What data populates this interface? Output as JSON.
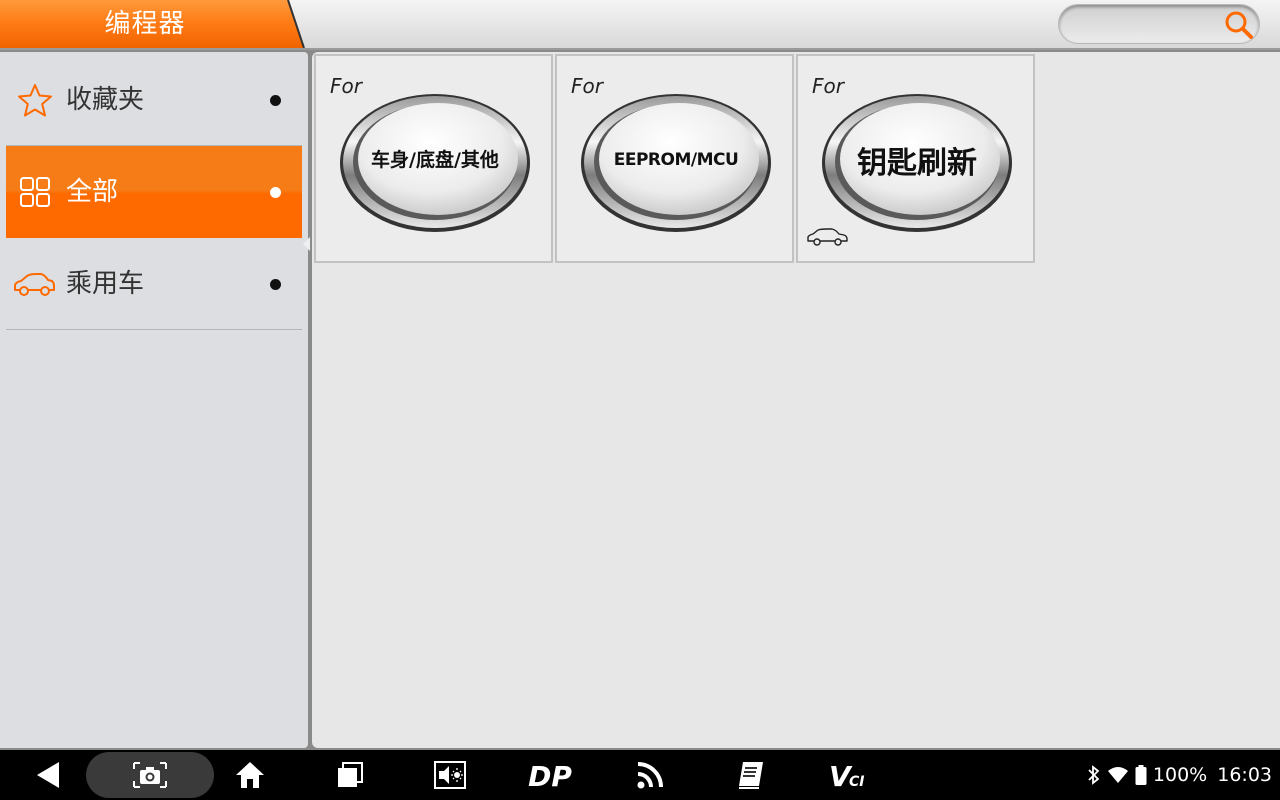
{
  "header": {
    "title": "编程器",
    "search": {
      "value": "",
      "placeholder": ""
    },
    "accent_color": "#ff6a00"
  },
  "sidebar": {
    "items": [
      {
        "label": "收藏夹",
        "icon": "star-icon",
        "active": false
      },
      {
        "label": "全部",
        "icon": "grid-icon",
        "active": true
      },
      {
        "label": "乘用车",
        "icon": "car-icon",
        "active": false
      }
    ]
  },
  "tiles": [
    {
      "for_label": "For",
      "label": "车身/底盘/其他",
      "icon": ""
    },
    {
      "for_label": "For",
      "label": "EEPROM/MCU",
      "icon": ""
    },
    {
      "for_label": "For",
      "label": "钥匙刷新",
      "icon": "car-icon"
    }
  ],
  "navbar": {
    "buttons": [
      "back-icon",
      "screenshot-icon",
      "home-icon",
      "recent-apps-icon",
      "volume-brightness-icon",
      "dp-icon",
      "rss-icon",
      "manual-icon",
      "vci-icon"
    ],
    "dp_label": "DP",
    "vci_label": "VCI"
  },
  "status": {
    "battery": "100%",
    "time": "16:03",
    "icons": [
      "bluetooth-icon",
      "wifi-icon",
      "battery-icon"
    ]
  }
}
